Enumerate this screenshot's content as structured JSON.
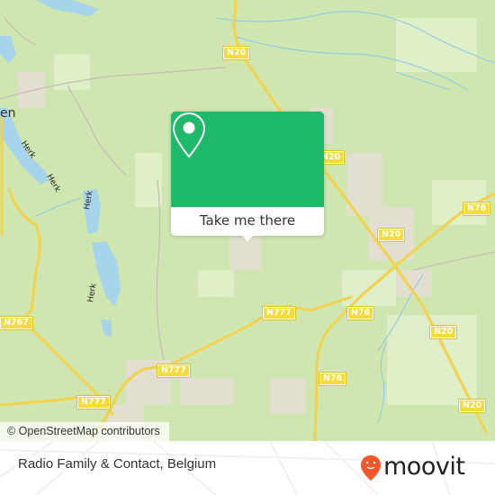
{
  "map": {
    "road_shields": [
      {
        "label": "N20",
        "pos": "top-center"
      },
      {
        "label": "N20",
        "pos": "right-of-popup"
      },
      {
        "label": "N20",
        "pos": "center-right"
      },
      {
        "label": "N76",
        "pos": "far-right"
      },
      {
        "label": "N777",
        "pos": "center"
      },
      {
        "label": "N76",
        "pos": "center-right-lower"
      },
      {
        "label": "N20",
        "pos": "right-lower"
      },
      {
        "label": "N767",
        "pos": "left"
      },
      {
        "label": "N777",
        "pos": "lower-left"
      },
      {
        "label": "N76",
        "pos": "bottom-center"
      },
      {
        "label": "N777",
        "pos": "bottom-left"
      },
      {
        "label": "N20",
        "pos": "bottom-right"
      }
    ],
    "river_labels": [
      "Herk",
      "Herk",
      "Herk",
      "Herk"
    ],
    "place_label_partial": "en",
    "attribution": "© OpenStreetMap contributors"
  },
  "popup": {
    "icon": "map-pin-icon",
    "button_label": "Take me there",
    "accent_color": "#1fb96a"
  },
  "footer": {
    "place_name": "Radio Family & Contact, Belgium",
    "brand": "moovit",
    "brand_color": "#f0582b"
  }
}
